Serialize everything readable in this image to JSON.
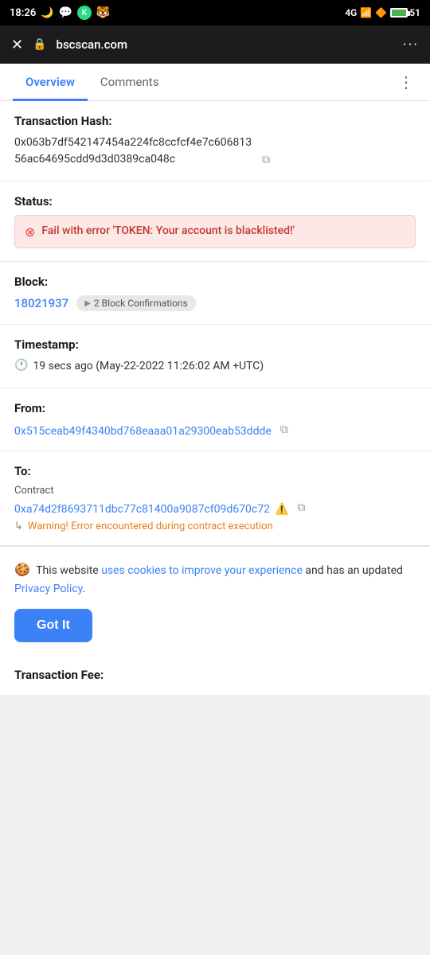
{
  "statusBar": {
    "time": "18:26",
    "battery": "51",
    "signal": "4G"
  },
  "browser": {
    "url": "bscscan.com",
    "menuLabel": "···"
  },
  "tabs": {
    "items": [
      {
        "id": "overview",
        "label": "Overview",
        "active": true
      },
      {
        "id": "comments",
        "label": "Comments",
        "active": false
      }
    ],
    "moreLabel": "⋮"
  },
  "transaction": {
    "hashLabel": "Transaction Hash:",
    "hashValue": "0x063b7df542147454a224fc8ccfcf4e7c606813",
    "hashValue2": "56ac64695cdd9d3d0389ca048c",
    "statusLabel": "Status:",
    "statusError": "Fail with error 'TOKEN: Your account is blacklisted!'",
    "blockLabel": "Block:",
    "blockNumber": "18021937",
    "blockConfirmations": "2 Block Confirmations",
    "timestampLabel": "Timestamp:",
    "timestampValue": "19 secs ago (May-22-2022 11:26:02 AM +UTC)",
    "fromLabel": "From:",
    "fromAddress": "0x515ceab49f4340bd768eaaa01a29300eab53d",
    "fromAddress2": "dde",
    "toLabel": "To:",
    "contractLabel": "Contract",
    "toAddress": "0xa74d2f8693711dbc77c81400a9087cf09d670",
    "toAddress2": "c72",
    "warningText": "Warning! Error encountered during contract execution"
  },
  "cookie": {
    "icon": "🍪",
    "text1": "This website ",
    "linkText1": "uses cookies to improve your experience",
    "text2": " and has an updated ",
    "linkText2": "Privacy Policy",
    "text3": ".",
    "buttonLabel": "Got It"
  },
  "fee": {
    "label": "Transaction Fee:"
  }
}
